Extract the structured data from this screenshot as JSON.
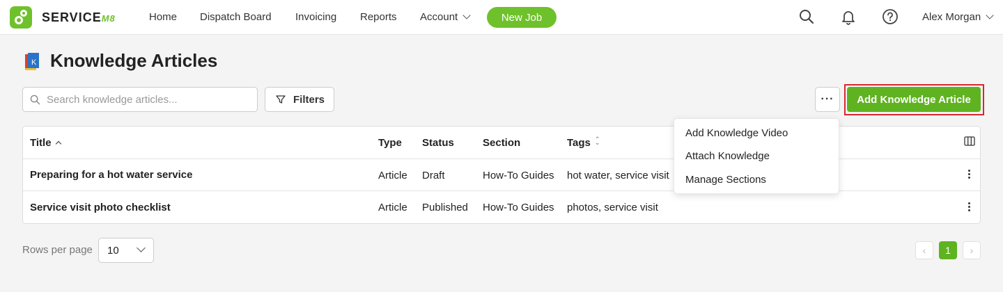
{
  "brand": {
    "name": "SERVICE",
    "suffix": "M8",
    "accent": "#6fc12b",
    "highlight": "#d9262b"
  },
  "nav": {
    "items": [
      "Home",
      "Dispatch Board",
      "Invoicing",
      "Reports",
      "Account"
    ],
    "new_job": "New Job",
    "user": "Alex Morgan",
    "icons": [
      "search-icon",
      "bell-icon",
      "help-icon"
    ]
  },
  "page": {
    "title": "Knowledge Articles",
    "icon": "book-icon"
  },
  "toolbar": {
    "search_placeholder": "Search knowledge articles...",
    "filters_label": "Filters",
    "more_label": "···",
    "add_label": "Add Knowledge Article"
  },
  "table": {
    "headers": [
      "Title",
      "Type",
      "Status",
      "Section",
      "Tags"
    ],
    "sort": {
      "column": "Title",
      "direction": "ascending"
    },
    "rows": [
      {
        "title": "Preparing for a hot water service",
        "type": "Article",
        "status": "Draft",
        "section": "How-To Guides",
        "tags": "hot water, service visit"
      },
      {
        "title": "Service visit photo checklist",
        "type": "Article",
        "status": "Published",
        "section": "How-To Guides",
        "tags": "photos, service visit"
      }
    ]
  },
  "dropdown": {
    "items": [
      "Add Knowledge Video",
      "Attach Knowledge",
      "Manage Sections"
    ]
  },
  "footer": {
    "rows_per_page_label": "Rows per page",
    "rows_per_page_value": "10",
    "current_page": "1"
  }
}
